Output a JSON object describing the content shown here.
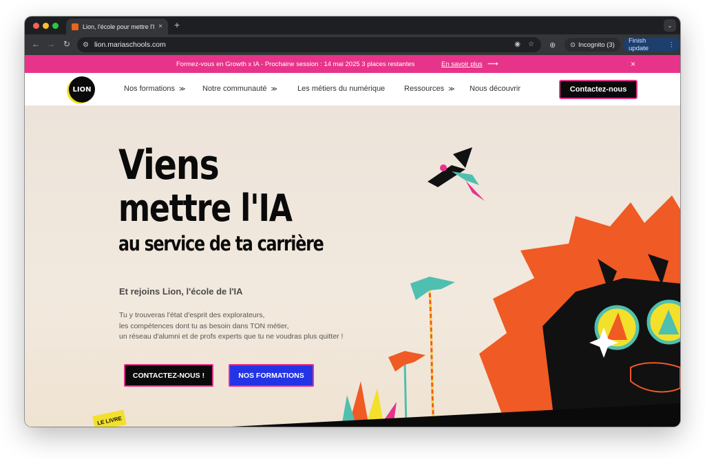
{
  "browser": {
    "tab_title": "Lion, l'école pour mettre l'IA a",
    "tab_close": "×",
    "new_tab": "+",
    "url": "lion.mariaschools.com",
    "incognito_label": "Incognito (3)",
    "update_label": "Finish update",
    "icons": {
      "back": "back-arrow-icon",
      "forward": "forward-arrow-icon",
      "reload": "reload-icon",
      "site_info": "site-info-icon",
      "eye_off": "eye-off-icon",
      "star": "bookmark-star-icon",
      "extension": "extension-icon",
      "incognito": "incognito-icon",
      "menu": "kebab-menu-icon"
    }
  },
  "promo": {
    "text": "Formez-vous en Growth x IA - Prochaine session : 14 mai 2025 3 places restantes",
    "link": "En savoir plus",
    "close": "×",
    "background": "#e8338a"
  },
  "nav": {
    "logo": "LION",
    "items": [
      {
        "label": "Nos formations",
        "has_dropdown": true
      },
      {
        "label": "Notre communauté",
        "has_dropdown": true
      },
      {
        "label": "Les métiers du numérique",
        "has_dropdown": false
      },
      {
        "label": "Ressources",
        "has_dropdown": true
      },
      {
        "label": "Nous découvrir",
        "has_dropdown": false
      }
    ],
    "contact_button": "Contactez-nous"
  },
  "hero": {
    "title_line1": "Viens",
    "title_line2": "mettre l'IA",
    "title_line3": "au service de ta carrière",
    "subtitle": "Et rejoins Lion, l'école de l'IA",
    "body_lines": [
      "Tu y trouveras l'état d'esprit des explorateurs,",
      "les compétences dont tu as besoin dans TON métier,",
      "un réseau d'alumni et de profs experts que tu ne voudras plus quitter !"
    ],
    "cta_contact": "CONTACTEZ-NOUS !",
    "cta_formations": "NOS FORMATIONS",
    "book_label": "LE LIVRE"
  },
  "colors": {
    "accent_pink": "#e8338a",
    "button_blue": "#2234e6",
    "lion_orange": "#f05a24",
    "palm_teal": "#4fbfb0",
    "hero_bg": "#f1e7dc"
  }
}
